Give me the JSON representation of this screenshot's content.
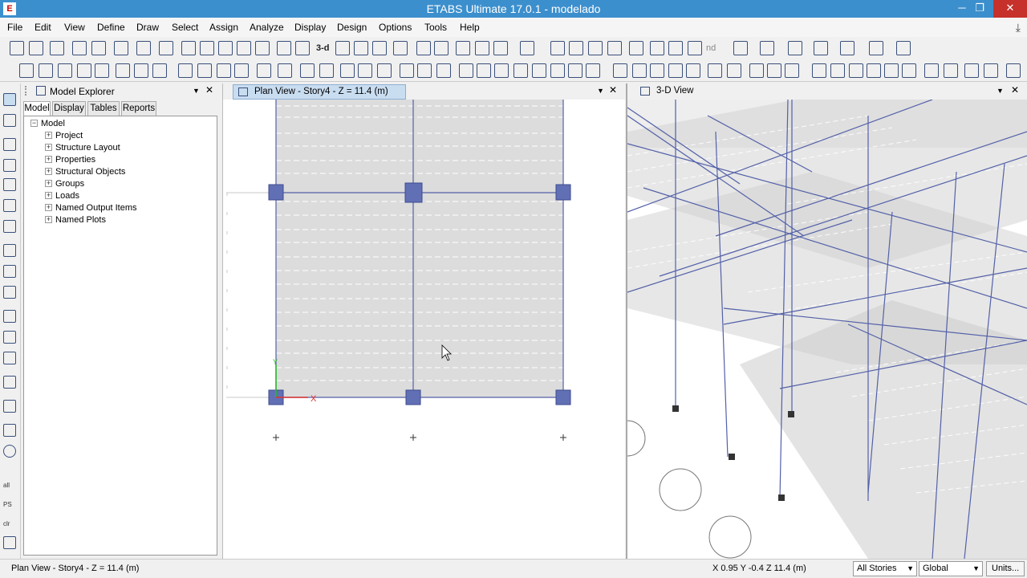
{
  "titlebar": {
    "title": "ETABS Ultimate 17.0.1 - modelado",
    "minimize": "─",
    "restore": "❐",
    "close": "✕"
  },
  "menu": {
    "items": [
      "File",
      "Edit",
      "View",
      "Define",
      "Draw",
      "Select",
      "Assign",
      "Analyze",
      "Display",
      "Design",
      "Options",
      "Tools",
      "Help"
    ]
  },
  "toolbar": {
    "three_d": "3-d",
    "nd": "nd"
  },
  "vtoolbar": {
    "all": "all",
    "ps": "PS",
    "clr": "clr"
  },
  "explorer": {
    "title": "Model Explorer",
    "tabs": [
      "Model",
      "Display",
      "Tables",
      "Reports"
    ],
    "root": "Model",
    "nodes": [
      "Project",
      "Structure Layout",
      "Properties",
      "Structural Objects",
      "Groups",
      "Loads",
      "Named Output Items",
      "Named Plots"
    ]
  },
  "planview": {
    "title": "Plan View - Story4 - Z = 11.4 (m)",
    "axis_x": "X",
    "axis_y": "Y"
  },
  "view3d": {
    "title": "3-D View"
  },
  "status": {
    "left": "Plan View - Story4 - Z = 11.4 (m)",
    "coords": "X 0.95  Y -0.4  Z 11.4 (m)",
    "stories": "All Stories",
    "coordsys": "Global",
    "units": "Units..."
  },
  "colors": {
    "titlebar": "#3c8fcd",
    "slab": "#d9d9d9",
    "joint": "#6170b5",
    "frame": "#5360a8"
  }
}
